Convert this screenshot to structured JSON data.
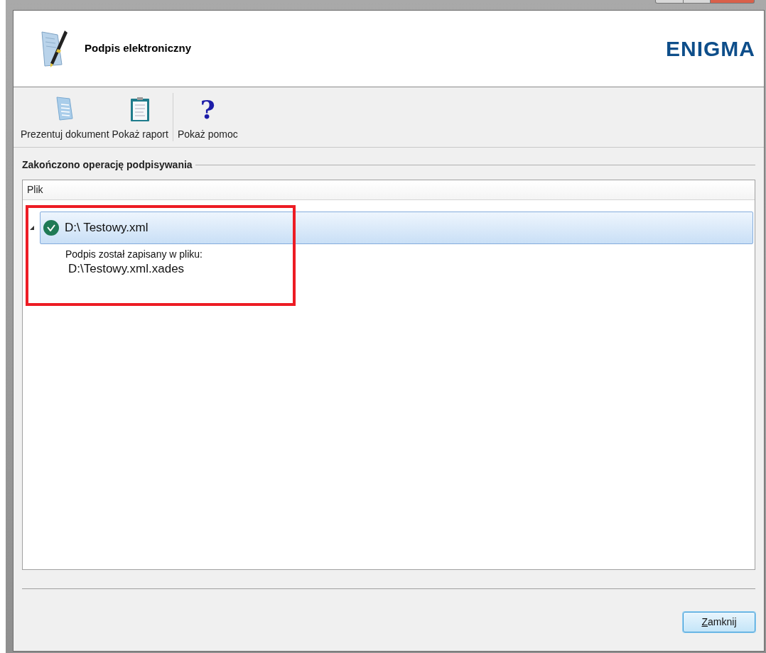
{
  "header": {
    "title": "Podpis elektroniczny",
    "logo": "ENIGMA"
  },
  "toolbar": {
    "groups": [
      [
        {
          "kind": "document",
          "label": "Prezentuj dokument"
        },
        {
          "kind": "report",
          "label": "Pokaż raport"
        }
      ],
      [
        {
          "kind": "help",
          "glyph": "?",
          "label": "Pokaż pomoc"
        }
      ]
    ]
  },
  "group": {
    "title": "Zakończono operację podpisywania"
  },
  "list": {
    "columns": [
      "Plik"
    ],
    "rows": [
      {
        "label": "D:\\ Testowy.xml",
        "signed": true,
        "expanded": true,
        "selected": true,
        "details": [
          "Podpis został zapisany w pliku:",
          "D:\\Testowy.xml.xades"
        ]
      }
    ]
  },
  "annotations": [
    {
      "kind": "rectangle"
    }
  ],
  "buttons": [
    "Zamknij"
  ]
}
